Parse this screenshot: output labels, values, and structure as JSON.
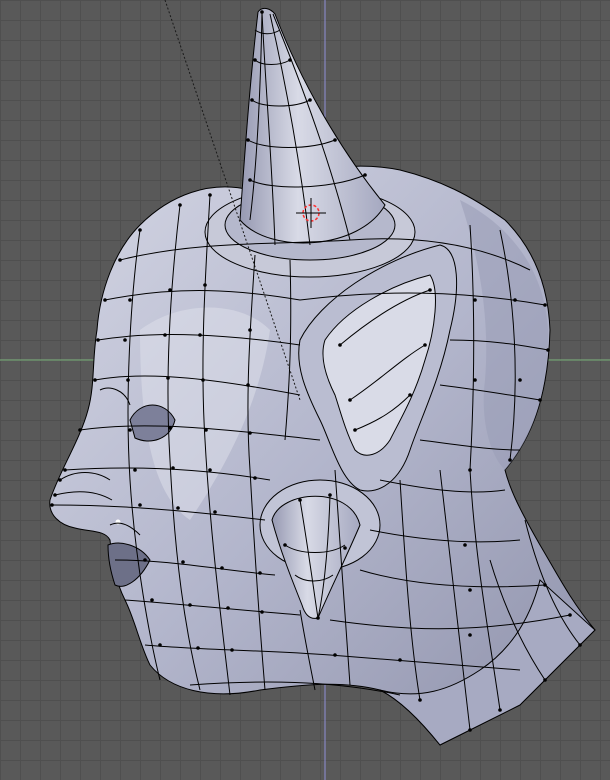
{
  "viewport": {
    "mode": "edit-mode-wireframe-over-solid",
    "view": "side-view",
    "object": "horned-head-mesh"
  },
  "colors": {
    "background": "#595959",
    "grid_line": "#4f4f4f",
    "axis_x": "#7fb87f",
    "axis_z": "#8f8fd8",
    "mesh_fill": "#b3b6cc",
    "mesh_shadow": "#8a8da6",
    "mesh_highlight": "#dcdeea",
    "wire": "#000000",
    "cursor_ring": "#ff3030"
  },
  "icons": {
    "cursor": "3d-cursor-icon"
  }
}
